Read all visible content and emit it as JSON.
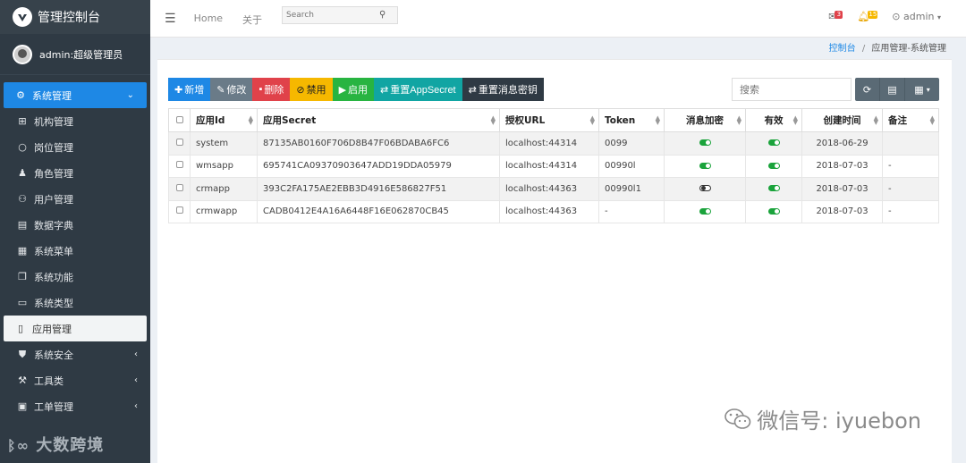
{
  "brand": {
    "title": "管理控制台"
  },
  "user_panel": {
    "name": "admin:超级管理员"
  },
  "sidebar": {
    "items": [
      {
        "label": "系统管理",
        "icon": "cogs-icon",
        "glyph": "⚙",
        "state": "active-group",
        "caret": "⌄"
      },
      {
        "label": "机构管理",
        "icon": "sitemap-icon",
        "glyph": "⊞",
        "state": ""
      },
      {
        "label": "岗位管理",
        "icon": "circle-icon",
        "glyph": "○",
        "state": ""
      },
      {
        "label": "角色管理",
        "icon": "user-role-icon",
        "glyph": "♟",
        "state": ""
      },
      {
        "label": "用户管理",
        "icon": "users-icon",
        "glyph": "⚇",
        "state": ""
      },
      {
        "label": "数据字典",
        "icon": "book-icon",
        "glyph": "▤",
        "state": ""
      },
      {
        "label": "系统菜单",
        "icon": "menu-book-icon",
        "glyph": "▦",
        "state": ""
      },
      {
        "label": "系统功能",
        "icon": "files-icon",
        "glyph": "❐",
        "state": ""
      },
      {
        "label": "系统类型",
        "icon": "document-icon",
        "glyph": "▭",
        "state": ""
      },
      {
        "label": "应用管理",
        "icon": "tablet-icon",
        "glyph": "▯",
        "state": "current"
      },
      {
        "label": "系统安全",
        "icon": "shield-icon",
        "glyph": "⛊",
        "state": "",
        "caret": "‹"
      },
      {
        "label": "工具类",
        "icon": "toolbox-icon",
        "glyph": "⚒",
        "state": "",
        "caret": "‹"
      },
      {
        "label": "工单管理",
        "icon": "ticket-icon",
        "glyph": "▣",
        "state": "",
        "caret": "‹"
      }
    ],
    "watermark": "大数跨境"
  },
  "topbar": {
    "nav": [
      "Home",
      "关于"
    ],
    "search_placeholder": "Search",
    "messages_count": "3",
    "notifications_count": "15",
    "admin_label": "admin"
  },
  "breadcrumb": {
    "home": "控制台",
    "separator": "/",
    "current": "应用管理-系统管理"
  },
  "toolbar": {
    "buttons": [
      {
        "label": "新增",
        "glyph": "✚",
        "color": "#1e88e5",
        "name": "add-button"
      },
      {
        "label": "修改",
        "glyph": "✎",
        "color": "#6a7b88",
        "name": "edit-button"
      },
      {
        "label": "删除",
        "glyph": "▪",
        "color": "#e0424a",
        "name": "delete-button"
      },
      {
        "label": "禁用",
        "glyph": "⊘",
        "color": "#f6b800",
        "name": "disable-button",
        "textColor": "#222"
      },
      {
        "label": "启用",
        "glyph": "▶",
        "color": "#28b441",
        "name": "enable-button"
      },
      {
        "label": "重置AppSecret",
        "glyph": "⇄",
        "color": "#11a5a3",
        "name": "reset-appsecret-button"
      },
      {
        "label": "重置消息密钥",
        "glyph": "⇄",
        "color": "#2f3a44",
        "name": "reset-message-key-button"
      }
    ],
    "search_placeholder": "搜索"
  },
  "table": {
    "columns": [
      "应用Id",
      "应用Secret",
      "授权URL",
      "Token",
      "消息加密",
      "有效",
      "创建时间",
      "备注"
    ],
    "rows": [
      {
        "id": "system",
        "secret": "87135AB0160F706D8B47F06BDABA6FC6",
        "url": "localhost:44314",
        "token": "0099",
        "encrypt": true,
        "valid": true,
        "created": "2018-06-29",
        "remark": ""
      },
      {
        "id": "wmsapp",
        "secret": "695741CA09370903647ADD19DDA05979",
        "url": "localhost:44314",
        "token": "00990l",
        "encrypt": true,
        "valid": true,
        "created": "2018-07-03",
        "remark": "-"
      },
      {
        "id": "crmapp",
        "secret": "393C2FA175AE2EBB3D4916E586827F51",
        "url": "localhost:44363",
        "token": "00990l1",
        "encrypt": false,
        "valid": true,
        "created": "2018-07-03",
        "remark": "-"
      },
      {
        "id": "crmwapp",
        "secret": "CADB0412E4A16A6448F16E062870CB45",
        "url": "localhost:44363",
        "token": "-",
        "encrypt": true,
        "valid": true,
        "created": "2018-07-03",
        "remark": "-"
      }
    ]
  },
  "watermark_text": "微信号: iyuebon"
}
